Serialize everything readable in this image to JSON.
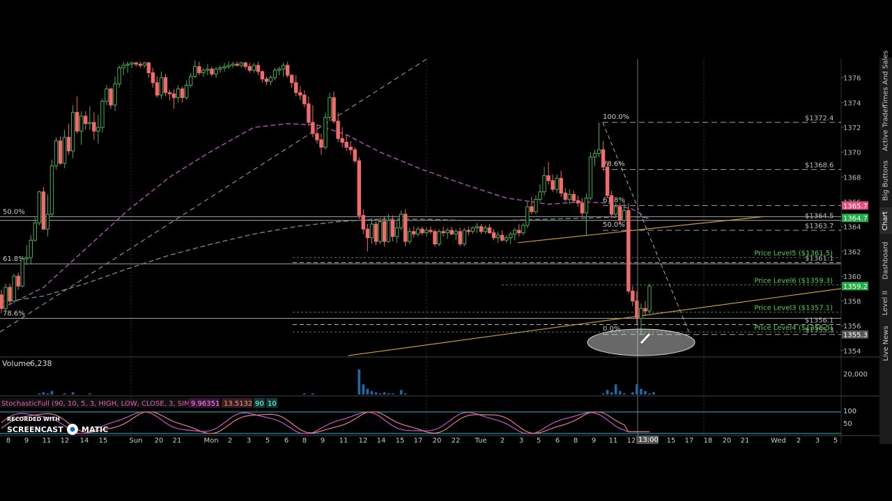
{
  "colors": {
    "background": "#000000",
    "grid": "#2a2a2a",
    "up_candle": "#4caf50",
    "down_candle": "#f06b6b",
    "sma": "#b455b4",
    "ema": "#5d8f86",
    "trendline": "#c89b30",
    "fib_line": "#cfcfcf",
    "price_level": "#3aa23a",
    "volume": "#1e6aa8",
    "stoch_k": "#cc55cc",
    "stoch_d": "#e08080",
    "price_tag_pink": "#e0507a",
    "price_tag_green": "#22aa44"
  },
  "side_tabs": [
    "Times And Sales",
    "Active Trader",
    "Big Buttons",
    "Chart",
    "Dashboard",
    "Level II",
    "Live News"
  ],
  "volume_panel": {
    "label": "Volume",
    "value": "6,238",
    "axis_label": "20,000"
  },
  "stochastic_panel": {
    "label": "StochasticFull (90, 10, 5, 3, HIGH, LOW, CLOSE, 3, SIMPLE)",
    "k_value": "9.96351",
    "d_value": "13.5132",
    "overbought": "90",
    "oversold": "10",
    "axis_labels": [
      "100",
      "50"
    ]
  },
  "watermark": {
    "line1": "RECORDED WITH",
    "line2a": "SCREENCAST",
    "line2b": "MATIC"
  },
  "current_time_tag": "13:00",
  "price_tags": [
    {
      "text": "1365.7",
      "price": 1365.7,
      "type": "pink"
    },
    {
      "text": "1364.7",
      "price": 1364.7,
      "type": "green"
    },
    {
      "text": "1359.2",
      "price": 1359.2,
      "type": "green"
    },
    {
      "text": "1355.3",
      "price": 1355.3,
      "type": "gray"
    }
  ],
  "chart_data": {
    "type": "candlestick",
    "y_range": [
      1353.6,
      1377.5
    ],
    "y_ticks": [
      1354,
      1356,
      1358,
      1360,
      1362,
      1364,
      1366,
      1368,
      1370,
      1372,
      1374,
      1376
    ],
    "x_ticks": [
      "8",
      "9",
      "11",
      "12",
      "14",
      "15",
      "Sun",
      "20",
      "21",
      "Mon",
      "2",
      "3",
      "5",
      "6",
      "8",
      "9",
      "11",
      "12",
      "14",
      "15",
      "17",
      "20",
      "22",
      "Tue",
      "2",
      "3",
      "5",
      "6",
      "8",
      "9",
      "11",
      "12",
      "15",
      "17",
      "18",
      "20",
      "21",
      "Wed",
      "2",
      "3",
      "5"
    ],
    "candles": [
      [
        1358.5,
        1358.9,
        1357.0,
        1357.4
      ],
      [
        1357.4,
        1359.4,
        1357.1,
        1359.1
      ],
      [
        1359.1,
        1359.4,
        1357.7,
        1358.0
      ],
      [
        1358.0,
        1360.2,
        1357.8,
        1360.0
      ],
      [
        1360.0,
        1360.3,
        1358.9,
        1359.2
      ],
      [
        1359.2,
        1361.6,
        1359.1,
        1361.4
      ],
      [
        1361.4,
        1362.5,
        1360.9,
        1361.5
      ],
      [
        1361.5,
        1363.3,
        1361.0,
        1362.9
      ],
      [
        1362.9,
        1364.7,
        1362.8,
        1364.3
      ],
      [
        1364.3,
        1366.9,
        1364.1,
        1366.8
      ],
      [
        1366.8,
        1367.2,
        1363.7,
        1363.8
      ],
      [
        1363.8,
        1366.6,
        1363.2,
        1365.0
      ],
      [
        1365.0,
        1369.4,
        1364.8,
        1368.9
      ],
      [
        1368.9,
        1371.2,
        1368.6,
        1370.9
      ],
      [
        1370.9,
        1371.3,
        1369.0,
        1369.1
      ],
      [
        1369.1,
        1371.8,
        1368.7,
        1371.2
      ],
      [
        1371.2,
        1372.3,
        1369.8,
        1370.1
      ],
      [
        1370.1,
        1373.8,
        1369.5,
        1373.2
      ],
      [
        1373.2,
        1374.5,
        1371.5,
        1371.7
      ],
      [
        1371.7,
        1373.3,
        1370.6,
        1372.9
      ],
      [
        1372.9,
        1373.3,
        1371.8,
        1372.3
      ],
      [
        1372.3,
        1373.7,
        1371.8,
        1372.4
      ],
      [
        1372.4,
        1373.2,
        1371.0,
        1371.7
      ],
      [
        1371.7,
        1373.0,
        1370.7,
        1372.0
      ],
      [
        1372.0,
        1374.3,
        1371.6,
        1374.1
      ],
      [
        1374.1,
        1375.4,
        1373.8,
        1375.1
      ],
      [
        1375.1,
        1375.2,
        1373.5,
        1373.8
      ],
      [
        1373.8,
        1376.1,
        1373.3,
        1375.5
      ],
      [
        1375.5,
        1377.0,
        1375.2,
        1376.8
      ],
      [
        1376.8,
        1377.3,
        1376.2,
        1377.0
      ],
      [
        1377.0,
        1377.3,
        1376.4,
        1377.1
      ],
      [
        1377.1,
        1377.3,
        1376.8,
        1377.2
      ],
      [
        1377.2,
        1377.3,
        1376.9,
        1377.1
      ],
      [
        1377.1,
        1377.3,
        1376.8,
        1377.0
      ],
      [
        1377.0,
        1377.3,
        1376.8,
        1377.2
      ],
      [
        1377.2,
        1377.3,
        1376.0,
        1376.4
      ],
      [
        1376.4,
        1376.8,
        1375.2,
        1375.6
      ],
      [
        1375.6,
        1376.1,
        1374.4,
        1374.6
      ],
      [
        1374.6,
        1376.5,
        1374.3,
        1376.0
      ],
      [
        1376.0,
        1376.3,
        1374.5,
        1374.8
      ],
      [
        1374.8,
        1375.0,
        1374.2,
        1374.7
      ],
      [
        1374.7,
        1375.1,
        1373.5,
        1374.4
      ],
      [
        1374.4,
        1375.4,
        1374.0,
        1375.1
      ],
      [
        1375.1,
        1375.3,
        1374.0,
        1374.4
      ],
      [
        1374.4,
        1375.8,
        1374.2,
        1375.4
      ],
      [
        1375.4,
        1376.4,
        1375.2,
        1376.1
      ],
      [
        1376.1,
        1377.4,
        1376.0,
        1376.9
      ],
      [
        1376.9,
        1377.3,
        1376.2,
        1376.4
      ],
      [
        1376.4,
        1376.8,
        1376.1,
        1376.6
      ],
      [
        1376.6,
        1377.1,
        1376.2,
        1376.7
      ],
      [
        1376.7,
        1376.9,
        1376.1,
        1376.3
      ],
      [
        1376.3,
        1376.9,
        1376.0,
        1376.7
      ],
      [
        1376.7,
        1377.0,
        1376.4,
        1376.8
      ],
      [
        1376.8,
        1377.2,
        1376.5,
        1376.9
      ],
      [
        1376.9,
        1377.3,
        1376.7,
        1377.0
      ],
      [
        1377.0,
        1377.3,
        1376.8,
        1377.1
      ],
      [
        1377.1,
        1377.3,
        1376.9,
        1377.0
      ],
      [
        1377.0,
        1377.3,
        1376.8,
        1377.2
      ],
      [
        1377.2,
        1377.3,
        1376.7,
        1376.9
      ],
      [
        1376.9,
        1377.2,
        1376.4,
        1376.6
      ],
      [
        1376.6,
        1377.2,
        1376.4,
        1377.0
      ],
      [
        1377.0,
        1377.3,
        1376.2,
        1376.5
      ],
      [
        1376.5,
        1376.6,
        1375.6,
        1375.9
      ],
      [
        1375.9,
        1376.1,
        1375.4,
        1375.7
      ],
      [
        1375.7,
        1376.2,
        1375.4,
        1376.0
      ],
      [
        1376.0,
        1376.8,
        1375.8,
        1376.6
      ],
      [
        1376.6,
        1376.9,
        1376.2,
        1376.7
      ],
      [
        1376.7,
        1377.2,
        1376.1,
        1377.0
      ],
      [
        1377.0,
        1377.3,
        1376.0,
        1376.2
      ],
      [
        1376.2,
        1376.3,
        1375.2,
        1375.6
      ],
      [
        1375.6,
        1376.2,
        1374.5,
        1374.8
      ],
      [
        1374.8,
        1375.3,
        1374.2,
        1374.6
      ],
      [
        1374.6,
        1375.0,
        1373.6,
        1373.9
      ],
      [
        1373.9,
        1374.5,
        1372.1,
        1372.4
      ],
      [
        1372.4,
        1373.8,
        1371.2,
        1371.5
      ],
      [
        1371.5,
        1372.2,
        1370.7,
        1371.0
      ],
      [
        1371.0,
        1371.5,
        1369.8,
        1370.4
      ],
      [
        1370.4,
        1373.2,
        1370.2,
        1372.8
      ],
      [
        1372.8,
        1374.8,
        1372.5,
        1374.4
      ],
      [
        1374.4,
        1374.9,
        1372.3,
        1372.5
      ],
      [
        1372.5,
        1373.2,
        1370.8,
        1371.1
      ],
      [
        1371.1,
        1372.0,
        1370.4,
        1370.8
      ],
      [
        1370.8,
        1371.4,
        1370.1,
        1370.4
      ],
      [
        1370.4,
        1370.9,
        1369.8,
        1370.2
      ],
      [
        1370.2,
        1370.4,
        1369.1,
        1369.3
      ],
      [
        1369.3,
        1369.6,
        1364.6,
        1364.9
      ],
      [
        1364.9,
        1365.4,
        1363.4,
        1363.8
      ],
      [
        1363.8,
        1364.2,
        1362.0,
        1363.1
      ],
      [
        1363.1,
        1364.7,
        1362.6,
        1364.2
      ],
      [
        1364.2,
        1364.4,
        1362.5,
        1362.8
      ],
      [
        1362.8,
        1364.7,
        1362.6,
        1364.4
      ],
      [
        1364.4,
        1364.8,
        1362.4,
        1362.8
      ],
      [
        1362.8,
        1365.0,
        1362.7,
        1364.5
      ],
      [
        1364.5,
        1364.9,
        1362.8,
        1363.2
      ],
      [
        1363.2,
        1364.4,
        1362.7,
        1363.9
      ],
      [
        1363.9,
        1365.3,
        1363.7,
        1365.0
      ],
      [
        1365.0,
        1365.4,
        1362.4,
        1362.8
      ],
      [
        1362.8,
        1363.9,
        1362.6,
        1363.6
      ],
      [
        1363.6,
        1364.0,
        1363.1,
        1363.4
      ],
      [
        1363.4,
        1364.0,
        1363.2,
        1363.8
      ],
      [
        1363.8,
        1364.0,
        1363.3,
        1363.5
      ],
      [
        1363.5,
        1363.9,
        1363.2,
        1363.7
      ],
      [
        1363.7,
        1364.0,
        1363.4,
        1363.6
      ],
      [
        1363.6,
        1363.8,
        1362.4,
        1362.6
      ],
      [
        1362.6,
        1363.8,
        1362.4,
        1363.6
      ],
      [
        1363.6,
        1364.0,
        1363.2,
        1363.5
      ],
      [
        1363.5,
        1363.9,
        1363.0,
        1363.7
      ],
      [
        1363.7,
        1364.0,
        1363.3,
        1363.4
      ],
      [
        1363.4,
        1363.8,
        1362.9,
        1363.6
      ],
      [
        1363.6,
        1363.9,
        1362.4,
        1362.6
      ],
      [
        1362.6,
        1363.9,
        1362.4,
        1363.7
      ],
      [
        1363.7,
        1364.0,
        1363.3,
        1363.6
      ],
      [
        1363.6,
        1364.0,
        1363.4,
        1363.9
      ],
      [
        1363.9,
        1364.3,
        1363.5,
        1364.0
      ],
      [
        1364.0,
        1364.2,
        1363.4,
        1363.6
      ],
      [
        1363.6,
        1364.1,
        1363.4,
        1363.9
      ],
      [
        1363.9,
        1364.2,
        1363.4,
        1363.5
      ],
      [
        1363.5,
        1363.8,
        1362.9,
        1363.1
      ],
      [
        1363.1,
        1363.6,
        1362.7,
        1363.3
      ],
      [
        1363.3,
        1363.7,
        1362.8,
        1362.9
      ],
      [
        1362.9,
        1363.3,
        1362.7,
        1363.1
      ],
      [
        1363.1,
        1363.6,
        1362.6,
        1363.4
      ],
      [
        1363.4,
        1363.9,
        1362.9,
        1363.7
      ],
      [
        1363.7,
        1364.2,
        1363.2,
        1363.5
      ],
      [
        1363.5,
        1364.3,
        1363.3,
        1364.1
      ],
      [
        1364.1,
        1366.0,
        1363.9,
        1365.6
      ],
      [
        1365.6,
        1366.4,
        1365.0,
        1365.2
      ],
      [
        1365.2,
        1366.5,
        1365.0,
        1366.2
      ],
      [
        1366.2,
        1367.4,
        1366.0,
        1366.8
      ],
      [
        1366.8,
        1368.8,
        1366.5,
        1368.1
      ],
      [
        1368.1,
        1369.2,
        1367.4,
        1367.7
      ],
      [
        1367.7,
        1368.2,
        1366.8,
        1367.0
      ],
      [
        1367.0,
        1368.2,
        1366.7,
        1367.9
      ],
      [
        1367.9,
        1368.5,
        1366.4,
        1366.7
      ],
      [
        1366.7,
        1367.1,
        1366.0,
        1366.2
      ],
      [
        1366.2,
        1367.0,
        1365.8,
        1366.6
      ],
      [
        1366.6,
        1366.9,
        1365.9,
        1366.1
      ],
      [
        1366.1,
        1366.5,
        1365.6,
        1365.9
      ],
      [
        1365.9,
        1366.3,
        1364.8,
        1365.1
      ],
      [
        1365.1,
        1366.7,
        1363.3,
        1366.3
      ],
      [
        1366.3,
        1370.0,
        1366.1,
        1369.6
      ],
      [
        1369.6,
        1370.2,
        1368.9,
        1369.9
      ],
      [
        1369.9,
        1372.4,
        1369.6,
        1370.2
      ],
      [
        1370.2,
        1370.9,
        1368.5,
        1368.8
      ],
      [
        1368.8,
        1369.2,
        1366.3,
        1366.5
      ],
      [
        1366.5,
        1366.9,
        1364.7,
        1365.0
      ],
      [
        1365.0,
        1365.9,
        1364.8,
        1365.6
      ],
      [
        1365.6,
        1365.9,
        1364.2,
        1364.5
      ],
      [
        1364.5,
        1366.2,
        1364.3,
        1365.3
      ],
      [
        1365.3,
        1365.9,
        1358.6,
        1358.8
      ],
      [
        1358.8,
        1359.2,
        1357.6,
        1358.0
      ],
      [
        1358.0,
        1358.8,
        1356.1,
        1356.6
      ],
      [
        1356.6,
        1357.8,
        1355.3,
        1357.4
      ],
      [
        1357.4,
        1358.0,
        1356.8,
        1357.2
      ],
      [
        1357.2,
        1359.4,
        1357.0,
        1359.2
      ]
    ],
    "sma_line": [
      [
        0,
        1357.4
      ],
      [
        10,
        1359.1
      ],
      [
        20,
        1362.2
      ],
      [
        30,
        1365.3
      ],
      [
        40,
        1368.0
      ],
      [
        50,
        1370.1
      ],
      [
        60,
        1372.0
      ],
      [
        68,
        1372.3
      ],
      [
        75,
        1372.2
      ],
      [
        82,
        1371.4
      ],
      [
        90,
        1370.0
      ],
      [
        100,
        1368.6
      ],
      [
        110,
        1367.4
      ],
      [
        120,
        1366.3
      ],
      [
        130,
        1365.8
      ],
      [
        138,
        1366.0
      ],
      [
        144,
        1365.9
      ],
      [
        150,
        1365.4
      ],
      [
        154,
        1364.6
      ]
    ],
    "ema_line": [
      [
        0,
        1357.9
      ],
      [
        10,
        1358.4
      ],
      [
        20,
        1359.4
      ],
      [
        30,
        1360.6
      ],
      [
        40,
        1361.7
      ],
      [
        50,
        1362.6
      ],
      [
        60,
        1363.4
      ],
      [
        70,
        1364.0
      ],
      [
        80,
        1364.4
      ],
      [
        90,
        1364.6
      ],
      [
        100,
        1364.6
      ],
      [
        110,
        1364.5
      ],
      [
        120,
        1364.5
      ],
      [
        130,
        1364.6
      ],
      [
        140,
        1364.7
      ],
      [
        150,
        1364.8
      ],
      [
        154,
        1364.7
      ]
    ],
    "retracement_left": {
      "labels": [
        "50.0%",
        "61.8%",
        "78.6%"
      ],
      "prices": [
        1364.8,
        1361.0,
        1356.6
      ]
    },
    "fib_right": {
      "labels": [
        "100.0%",
        "78.6%",
        "61.8%",
        "50.0%",
        "0.0%"
      ],
      "prices": [
        1372.4,
        1368.6,
        1365.7,
        1363.7,
        1355.3
      ],
      "price_labels": [
        "$1372.4",
        "$1368.6",
        "$1365.7",
        "$1363.7",
        "$1355.3"
      ]
    },
    "horizontal_lines": {
      "prices": [
        1364.5,
        1361.1,
        1356.1
      ],
      "labels": [
        "$1364.5",
        "$1361.1",
        "$1356.1"
      ]
    },
    "price_levels": {
      "labels": [
        "Price Level5 ($1361.5)",
        "Price Level6 ($1359.3)",
        "Price Level3 ($1357.1)",
        "Price Level4 ($1355.5)"
      ],
      "prices": [
        1361.5,
        1359.3,
        1357.1,
        1355.5
      ]
    },
    "volume": [
      0,
      0,
      0,
      0,
      0,
      0,
      0,
      0,
      0,
      1,
      2,
      1,
      3,
      0,
      0,
      1,
      0,
      2,
      0,
      0,
      0,
      1,
      0,
      0,
      0,
      0,
      0,
      0,
      0,
      0,
      0,
      0,
      0,
      0,
      0,
      0,
      0,
      0,
      0,
      0,
      0,
      0,
      0,
      0,
      0,
      0,
      0,
      0,
      0,
      0,
      0,
      0,
      0,
      0,
      0,
      0,
      0,
      0,
      0,
      0,
      0,
      0,
      0,
      0,
      0,
      0,
      0,
      0,
      0,
      0,
      0,
      0,
      1,
      0,
      1,
      0,
      0,
      0,
      0,
      0,
      0,
      0,
      0,
      0,
      0,
      22,
      9,
      5,
      3,
      2,
      1,
      2,
      1,
      1,
      0,
      4,
      1,
      0,
      0,
      0,
      0,
      0,
      0,
      0,
      0,
      0,
      0,
      0,
      0,
      0,
      0,
      0,
      0,
      0,
      0,
      0,
      0,
      0,
      0,
      0,
      0,
      0,
      0,
      0,
      0,
      0,
      0,
      0,
      0,
      0,
      0,
      0,
      0,
      0,
      0,
      0,
      0,
      0,
      0,
      0,
      0,
      0,
      0,
      1,
      4,
      2,
      9,
      3,
      1,
      0,
      2,
      9,
      5,
      3,
      1,
      2
    ]
  }
}
